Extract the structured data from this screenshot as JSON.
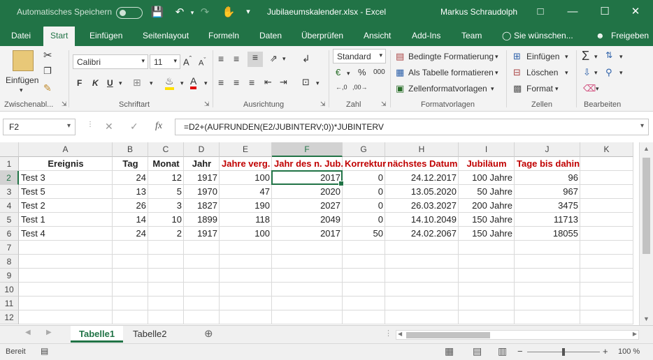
{
  "titlebar": {
    "autosave_label": "Automatisches Speichern",
    "document_title": "Jubilaeumskalender.xlsx  -  Excel",
    "user_name": "Markus Schraudolph"
  },
  "tabs": [
    "Datei",
    "Start",
    "Einfügen",
    "Seitenlayout",
    "Formeln",
    "Daten",
    "Überprüfen",
    "Ansicht",
    "Add-Ins",
    "Team"
  ],
  "tell_me": "Sie wünschen...",
  "share": "Freigeben",
  "ribbon": {
    "paste_label": "Einfügen",
    "font_name": "Calibri",
    "font_size": "11",
    "number_format": "Standard",
    "cond_format": "Bedingte Formatierung",
    "as_table": "Als Tabelle formatieren",
    "cell_styles": "Zellenformatvorlagen",
    "insert": "Einfügen",
    "delete": "Löschen",
    "format": "Format",
    "groups": {
      "clipboard": "Zwischenabl...",
      "font": "Schriftart",
      "alignment": "Ausrichtung",
      "number": "Zahl",
      "styles": "Formatvorlagen",
      "cells": "Zellen",
      "editing": "Bearbeiten"
    },
    "bold": "F",
    "italic": "K",
    "underline": "U"
  },
  "formula_bar": {
    "name_box": "F2",
    "formula": "=D2+(AUFRUNDEN(E2/JUBINTERV;0))*JUBINTERV"
  },
  "grid": {
    "columns": [
      "A",
      "B",
      "C",
      "D",
      "E",
      "F",
      "G",
      "H",
      "I",
      "J",
      "K"
    ],
    "row_numbers": [
      "1",
      "2",
      "3",
      "4",
      "5",
      "6",
      "7",
      "8",
      "9",
      "10",
      "11",
      "12"
    ],
    "headers": [
      "Ereignis",
      "Tag",
      "Monat",
      "Jahr",
      "Jahre verg.",
      "Jahr des n. Jub.",
      "Korrektur",
      "nächstes Datum",
      "Jubiläum",
      "Tage bis dahin"
    ],
    "rows": [
      [
        "Test 3",
        "24",
        "12",
        "1917",
        "100",
        "2017",
        "0",
        "24.12.2017",
        "100 Jahre",
        "96"
      ],
      [
        "Test 5",
        "13",
        "5",
        "1970",
        "47",
        "2020",
        "0",
        "13.05.2020",
        "50 Jahre",
        "967"
      ],
      [
        "Test 2",
        "26",
        "3",
        "1827",
        "190",
        "2027",
        "0",
        "26.03.2027",
        "200 Jahre",
        "3475"
      ],
      [
        "Test 1",
        "14",
        "10",
        "1899",
        "118",
        "2049",
        "0",
        "14.10.2049",
        "150 Jahre",
        "11713"
      ],
      [
        "Test 4",
        "24",
        "2",
        "1917",
        "100",
        "2017",
        "50",
        "24.02.2067",
        "150 Jahre",
        "18055"
      ]
    ]
  },
  "sheets": [
    "Tabelle1",
    "Tabelle2"
  ],
  "status": {
    "ready": "Bereit",
    "zoom": "100 %"
  },
  "colors": {
    "accent": "#217346",
    "header_red": "#c00000"
  }
}
